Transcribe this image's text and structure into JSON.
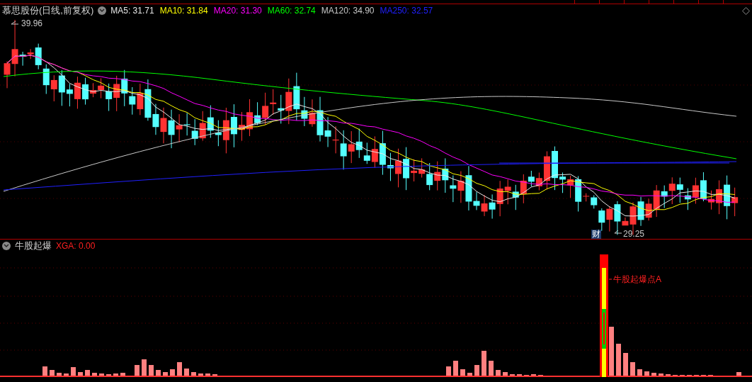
{
  "stock": {
    "title": "慕思股份(日线,前复权)"
  },
  "ma_readings": [
    {
      "label": "MA5:",
      "value": "31.71",
      "color": "#e8e8e8"
    },
    {
      "label": "MA10:",
      "value": "31.84",
      "color": "#ffff00"
    },
    {
      "label": "MA20:",
      "value": "31.30",
      "color": "#ff00ff"
    },
    {
      "label": "MA60:",
      "value": "32.74",
      "color": "#00ff00"
    },
    {
      "label": "MA120:",
      "value": "34.90",
      "color": "#c8c8c8"
    },
    {
      "label": "MA250:",
      "value": "32.57",
      "color": "#2020ff"
    }
  ],
  "price_marks": {
    "high": "39.96",
    "low": "29.25",
    "badge": "财"
  },
  "indicator": {
    "title": "牛股起爆",
    "reading": "XGA: 0.00",
    "annotation": "牛股起爆点A"
  }
}
